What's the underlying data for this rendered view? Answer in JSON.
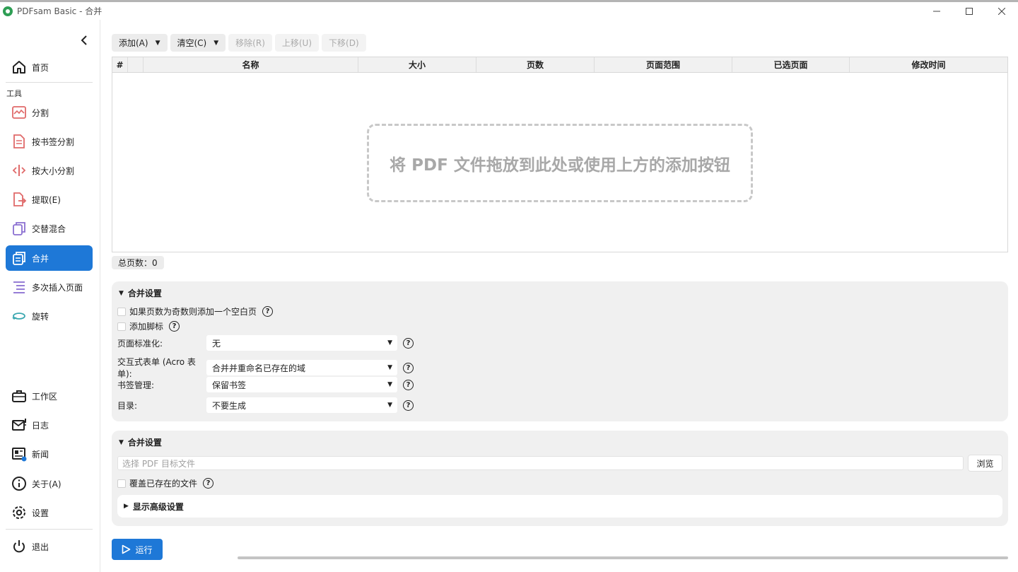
{
  "window": {
    "title": "PDFsam Basic - 合并"
  },
  "sidebar": {
    "home": "首页",
    "tools_label": "工具",
    "tools": [
      {
        "label": "分割",
        "icon": "split-icon"
      },
      {
        "label": "按书签分割",
        "icon": "split-bookmarks-icon"
      },
      {
        "label": "按大小分割",
        "icon": "split-size-icon"
      },
      {
        "label": "提取(E)",
        "icon": "extract-icon"
      },
      {
        "label": "交替混合",
        "icon": "alternate-mix-icon"
      },
      {
        "label": "合并",
        "icon": "merge-icon"
      },
      {
        "label": "多次插入页面",
        "icon": "insert-pages-icon"
      },
      {
        "label": "旋转",
        "icon": "rotate-icon"
      }
    ],
    "bottom": [
      {
        "label": "工作区",
        "icon": "workspace-icon"
      },
      {
        "label": "日志",
        "icon": "log-icon"
      },
      {
        "label": "新闻",
        "icon": "news-icon"
      },
      {
        "label": "关于(A)",
        "icon": "info-icon"
      },
      {
        "label": "设置",
        "icon": "gear-icon"
      }
    ],
    "exit": "退出"
  },
  "toolbar": {
    "add": "添加(A)",
    "clear": "清空(C)",
    "remove": "移除(R)",
    "move_up": "上移(U)",
    "move_down": "下移(D)"
  },
  "table": {
    "columns": [
      "#",
      "",
      "名称",
      "大小",
      "页数",
      "页面范围",
      "已选页面",
      "修改时间"
    ],
    "drop_hint": "将 PDF 文件拖放到此处或使用上方的添加按钮"
  },
  "total_pages": "总页数：0",
  "merge_settings": {
    "title": "合并设置",
    "blank_page": "如果页数为奇数则添加一个空白页",
    "footer": "添加脚标",
    "normalization_label": "页面标准化:",
    "normalization_value": "无",
    "acro_label": "交互式表单 (Acro 表单):",
    "acro_value": "合并并重命名已存在的域",
    "bookmarks_label": "书签管理:",
    "bookmarks_value": "保留书签",
    "toc_label": "目录:",
    "toc_value": "不要生成"
  },
  "output_settings": {
    "title": "合并设置",
    "dest_placeholder": "选择 PDF 目标文件",
    "browse": "浏览",
    "overwrite": "覆盖已存在的文件",
    "advanced": "显示高级设置"
  },
  "run": "运行",
  "colors": {
    "accent": "#1e78d7",
    "icon_red": "#e06a6a",
    "icon_purple": "#8a6fd1",
    "icon_teal": "#3aa7b0"
  }
}
